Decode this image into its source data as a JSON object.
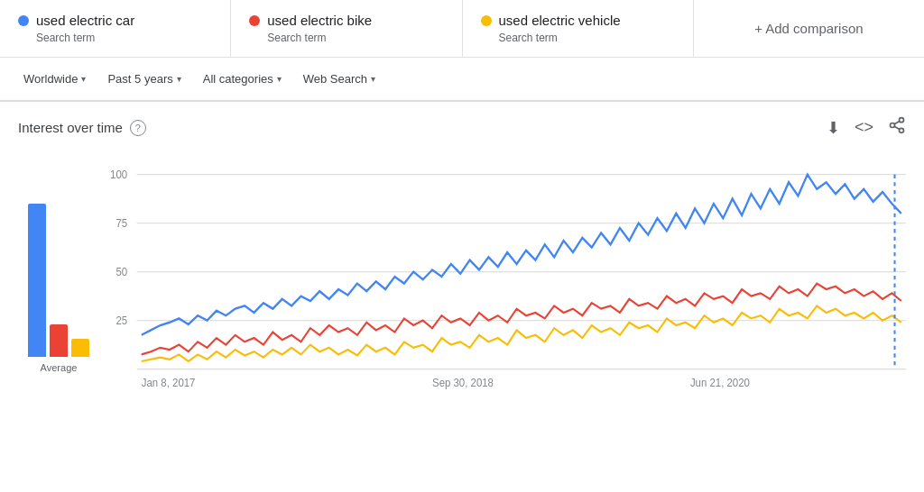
{
  "search_terms": [
    {
      "id": "term-1",
      "name": "used electric car",
      "type": "Search term",
      "dot_class": "dot-blue"
    },
    {
      "id": "term-2",
      "name": "used electric bike",
      "type": "Search term",
      "dot_class": "dot-red"
    },
    {
      "id": "term-3",
      "name": "used electric vehicle",
      "type": "Search term",
      "dot_class": "dot-yellow"
    }
  ],
  "add_comparison_label": "+ Add comparison",
  "filters": {
    "location": "Worldwide",
    "time_range": "Past 5 years",
    "category": "All categories",
    "search_type": "Web Search"
  },
  "interest_section": {
    "title": "Interest over time",
    "help_text": "?",
    "actions": {
      "download": "⬇",
      "embed": "<>",
      "share": "⎋"
    }
  },
  "chart": {
    "y_labels": [
      "100",
      "75",
      "50",
      "25"
    ],
    "x_labels": [
      "Jan 8, 2017",
      "Sep 30, 2018",
      "Jun 21, 2020"
    ],
    "avg_label": "Average",
    "avg_bars": [
      {
        "color": "#4285f4",
        "height_pct": 85
      },
      {
        "color": "#ea4335",
        "height_pct": 18
      },
      {
        "color": "#fbbc04",
        "height_pct": 10
      }
    ]
  }
}
